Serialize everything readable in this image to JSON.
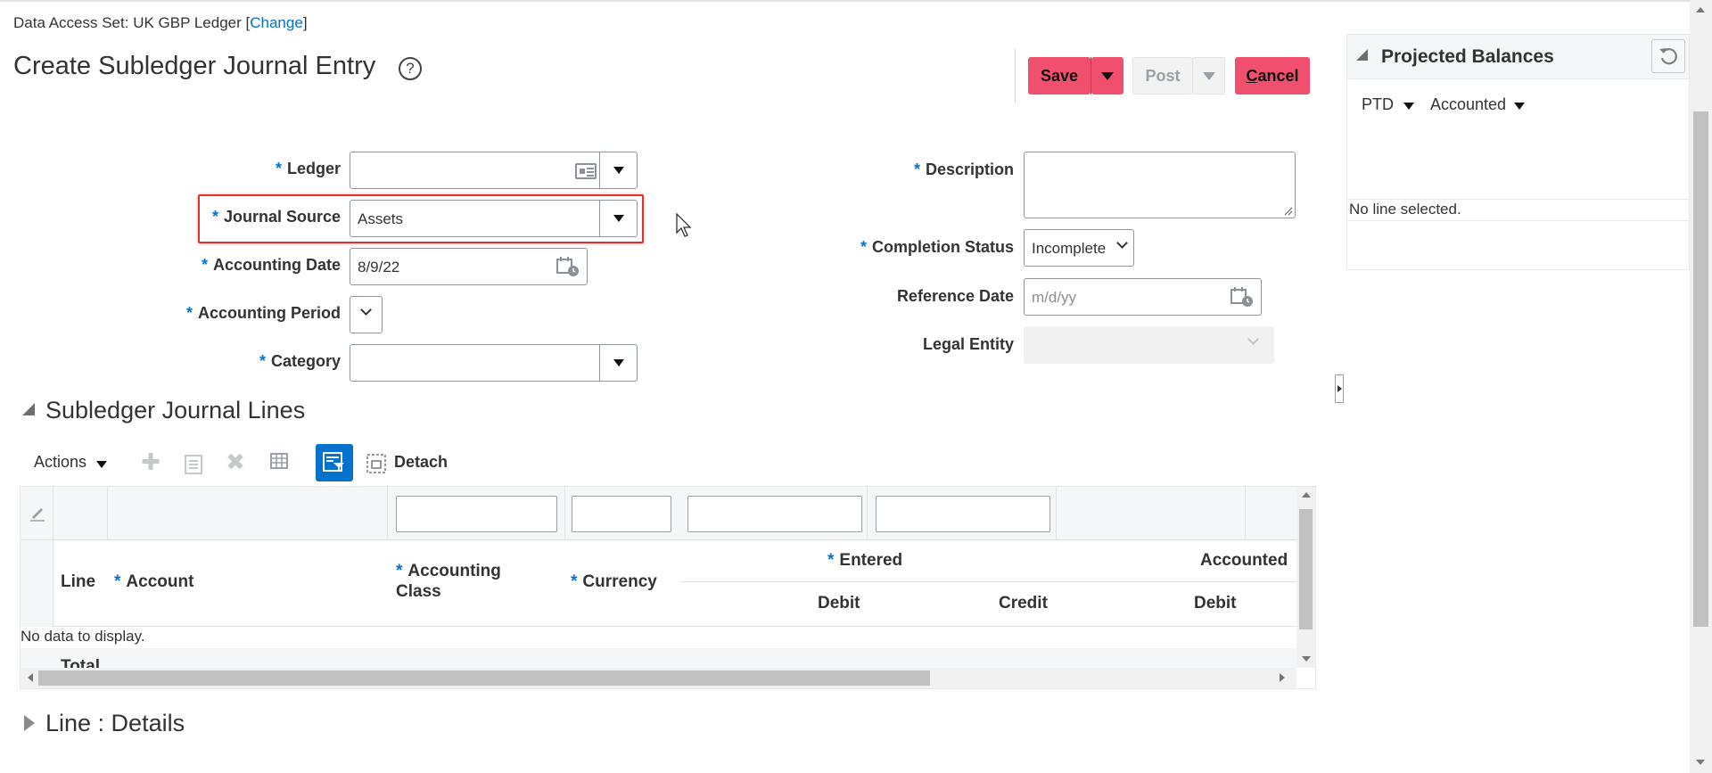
{
  "header": {
    "das_label": "Data Access Set:",
    "das_value": "UK GBP Ledger",
    "change_open": "[",
    "change_link": "Change",
    "change_close": "]",
    "page_title": "Create Subledger Journal Entry",
    "help_glyph": "?"
  },
  "toolbar": {
    "save": "Save",
    "post": "Post",
    "cancel_first": "C",
    "cancel_rest": "ancel"
  },
  "form": {
    "ledger_label": "Ledger",
    "ledger_value": "",
    "journal_source_label": "Journal Source",
    "journal_source_value": "Assets",
    "accounting_date_label": "Accounting Date",
    "accounting_date_value": "8/9/22",
    "accounting_period_label": "Accounting Period",
    "category_label": "Category",
    "description_label": "Description",
    "completion_status_label": "Completion Status",
    "completion_status_value": "Incomplete",
    "reference_date_label": "Reference Date",
    "reference_date_placeholder": "m/d/yy",
    "legal_entity_label": "Legal Entity",
    "required_mark": "*"
  },
  "lines": {
    "section_title": "Subledger Journal Lines",
    "actions": "Actions",
    "detach": "Detach",
    "columns": {
      "line": "Line",
      "account": "Account",
      "accounting_class_1": "Accounting",
      "accounting_class_2": "Class",
      "currency": "Currency",
      "entered": "Entered",
      "accounted": "Accounted",
      "debit": "Debit",
      "credit": "Credit",
      "debit2": "Debit"
    },
    "empty": "No data to display.",
    "total": "Total"
  },
  "details": {
    "section_title": "Line : Details"
  },
  "projected": {
    "title": "Projected Balances",
    "ptd": "PTD",
    "accounted": "Accounted",
    "empty": "No line selected."
  },
  "colors": {
    "accent": "#0572ce",
    "button_pink": "#f0506e",
    "highlight": "#e0312f"
  }
}
